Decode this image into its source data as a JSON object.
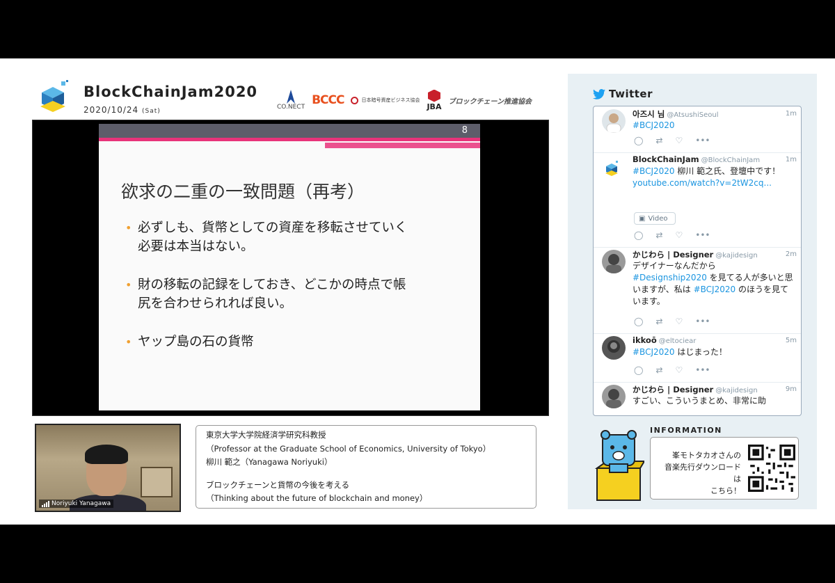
{
  "brand": {
    "title": "BlockChainJam2020",
    "date": "2020/10/24",
    "day": "(Sat)"
  },
  "sponsors": {
    "conect": "CO.NECT",
    "bcca": "BCCC",
    "jcba": "日本暗号資産ビジネス協会",
    "jba": "JBA",
    "alliance": "ブロックチェーン推進協会"
  },
  "slide": {
    "page": "8",
    "title": "欲求の二重の一致問題（再考）",
    "bullets": [
      {
        "line1": "必ずしも、貨幣としての資産を移転させていく",
        "line2": "必要は本当はない。"
      },
      {
        "line1": "財の移転の記録をしておき、どこかの時点で帳",
        "line2": "尻を合わせられれば良い。"
      },
      {
        "line1": "ヤップ島の石の貨幣",
        "line2": ""
      }
    ]
  },
  "presenter": {
    "name": "Noriyuki Yanagawa"
  },
  "info": {
    "affiliation_ja": "東京大学大学院経済学研究科教授",
    "affiliation_en": "（Professor at the Graduate School of Economics, University of Tokyo）",
    "name": "柳川 範之（Yanagawa Noriyuki）",
    "talk_ja": "ブロックチェーンと貨幣の今後を考える",
    "talk_en": "（Thinking about the future of blockchain and money）"
  },
  "twitter": {
    "title": "Twitter",
    "tweets": [
      {
        "name": "아즈시 님",
        "handle": "@AtsushiSeoul",
        "time": "1m",
        "text": "#BCJ2020"
      },
      {
        "name": "BlockChainJam",
        "handle": "@BlockChainJam",
        "time": "1m",
        "tag": "#BCJ2020",
        "text": " 柳川 範之氏、登壇中です！",
        "link": "youtube.com/watch?v=2tW2cq...",
        "chip": "Video"
      },
      {
        "name": "かじわら | Designer",
        "handle": "@kajidesign",
        "time": "2m",
        "text1": "デザイナーなんだから",
        "tag1": "#Designship2020",
        "text2": " を見てる人が多いと思いますが、私は ",
        "tag2": "#BCJ2020",
        "text3": " のほうを見ています。"
      },
      {
        "name": "ikkoō",
        "handle": "@eltociear",
        "time": "5m",
        "tag": "#BCJ2020",
        "text": " はじまった！"
      },
      {
        "name": "かじわら | Designer",
        "handle": "@kajidesign",
        "time": "9m",
        "text": "すごい、こういうまとめ、非常に助"
      }
    ]
  },
  "information": {
    "title": "INFORMATION",
    "line1": "峯モトタカオさんの",
    "line2": "音楽先行ダウンロードは",
    "line3": "こちら！"
  },
  "colors": {
    "accent_pink": "#e8337a",
    "twitter_blue": "#1b95e0",
    "panel_bg": "#e8f0f4"
  }
}
